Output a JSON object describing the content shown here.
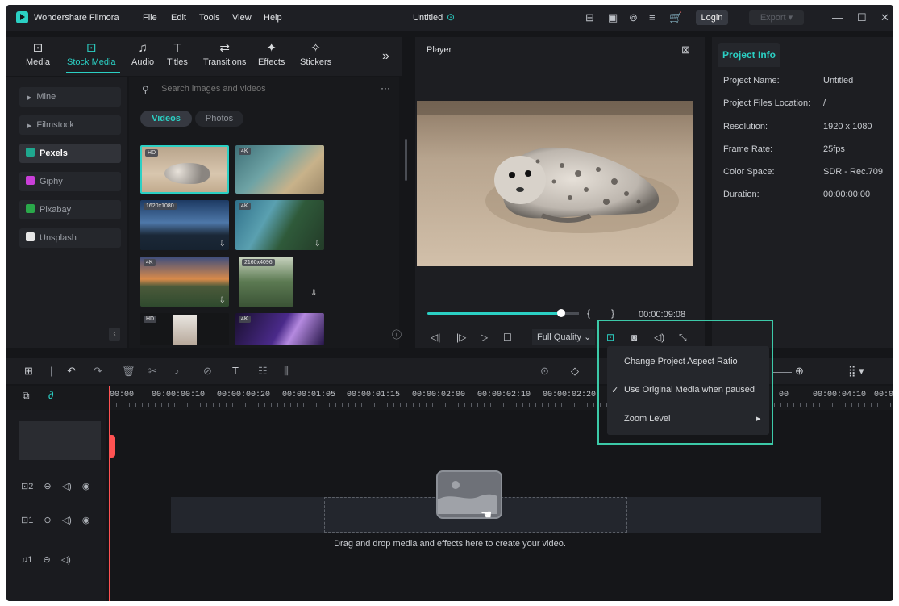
{
  "app": {
    "name": "Wondershare Filmora",
    "menu": [
      "File",
      "Edit",
      "Tools",
      "View",
      "Help"
    ],
    "project_title": "Untitled",
    "login_label": "Login",
    "export_label": "Export"
  },
  "media_tabs": [
    {
      "label": "Media",
      "icon": "media-icon"
    },
    {
      "label": "Stock Media",
      "icon": "stock-media-icon",
      "active": true
    },
    {
      "label": "Audio",
      "icon": "music-note-icon"
    },
    {
      "label": "Titles",
      "icon": "text-t-icon"
    },
    {
      "label": "Transitions",
      "icon": "transition-icon"
    },
    {
      "label": "Effects",
      "icon": "effects-star-icon"
    },
    {
      "label": "Stickers",
      "icon": "sticker-icon"
    }
  ],
  "sidebar": [
    {
      "label": "Mine"
    },
    {
      "label": "Filmstock"
    },
    {
      "label": "Pexels",
      "selected": true
    },
    {
      "label": "Giphy"
    },
    {
      "label": "Pixabay"
    },
    {
      "label": "Unsplash"
    }
  ],
  "browser": {
    "search_placeholder": "Search images and videos",
    "tab_videos": "Videos",
    "tab_photos": "Photos",
    "thumbs": [
      {
        "badge": "HD"
      },
      {
        "badge": "4K"
      },
      {
        "badge": "1620x1080"
      },
      {
        "badge": "4K"
      },
      {
        "badge": "4K"
      },
      {
        "badge": "2160x4096"
      },
      {
        "badge": "HD"
      },
      {
        "badge": "4K"
      }
    ]
  },
  "player": {
    "label": "Player",
    "timecode": "00:00:09:08",
    "quality": "Full Quality",
    "progress": 0.89
  },
  "project_info": {
    "tab_label": "Project Info",
    "rows": [
      {
        "key": "Project Name:",
        "value": "Untitled"
      },
      {
        "key": "Project Files Location:",
        "value": "/"
      },
      {
        "key": "Resolution:",
        "value": "1920 x 1080"
      },
      {
        "key": "Frame Rate:",
        "value": "25fps"
      },
      {
        "key": "Color Space:",
        "value": "SDR - Rec.709"
      },
      {
        "key": "Duration:",
        "value": "00:00:00:00"
      }
    ]
  },
  "timeline": {
    "ruler": [
      "00:00",
      "00:00:00:10",
      "00:00:00:20",
      "00:00:01:05",
      "00:00:01:15",
      "00:00:02:00",
      "00:00:02:10",
      "00:00:02:20",
      "00",
      "00:00:04:10",
      "00:00:"
    ],
    "tracks": [
      {
        "label": "2"
      },
      {
        "label": "1"
      },
      {
        "label": "1"
      }
    ],
    "drop_message": "Drag and drop media and effects here to create your video."
  },
  "context_menu": {
    "items": [
      {
        "label": "Change Project Aspect Ratio"
      },
      {
        "label": "Use Original Media when paused",
        "checked": true
      },
      {
        "label": "Zoom Level",
        "submenu": true
      }
    ]
  },
  "colors": {
    "accent": "#2bd0c4",
    "playhead": "#ff5252",
    "highlight_border": "#3cc9a8"
  }
}
